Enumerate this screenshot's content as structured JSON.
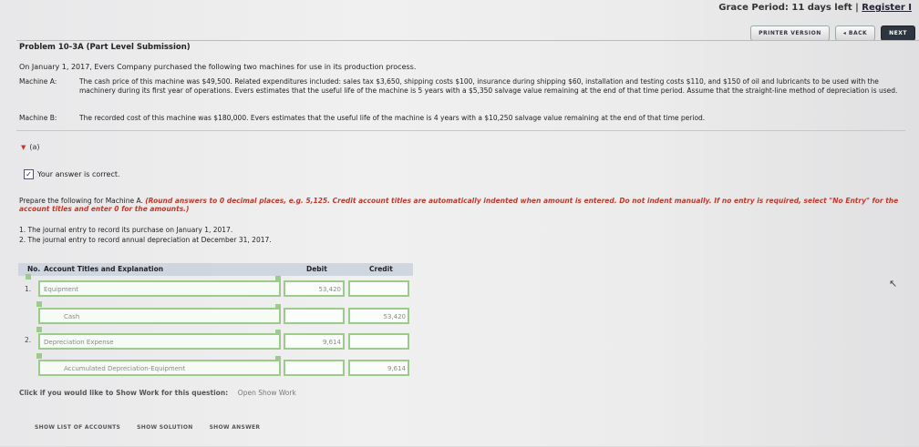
{
  "header": {
    "grace_text": "Grace Period: 11 days left",
    "separator": "|",
    "register_link": "Register I",
    "printer_version": "PRINTER VERSION",
    "back": "◂ BACK",
    "next": "NEXT"
  },
  "problem": {
    "title": "Problem 10-3A (Part Level Submission)",
    "intro": "On January 1, 2017, Evers Company purchased the following two machines for use in its production process.",
    "machine_a_label": "Machine A:",
    "machine_a_text": "The cash price of this machine was $49,500. Related expenditures included: sales tax $3,650, shipping costs $100, insurance during shipping $60, installation and testing costs $110, and $150 of oil and lubricants to be used with the machinery during its first year of operations. Evers estimates that the useful life of the machine is 5 years with a $5,350 salvage value remaining at the end of that time period. Assume that the straight-line method of depreciation is used.",
    "machine_b_label": "Machine B:",
    "machine_b_text": "The recorded cost of this machine was $180,000. Evers estimates that the useful life of the machine is 4 years with a $10,250 salvage value remaining at the end of that time period."
  },
  "part": {
    "label": "(a)",
    "correct_text": "Your answer is correct.",
    "instruction_plain": "Prepare the following for Machine A. ",
    "instruction_red": "(Round answers to 0 decimal places, e.g. 5,125. Credit account titles are automatically indented when amount is entered. Do not indent manually. If no entry is required, select \"No Entry\" for the account titles and enter 0 for the amounts.)",
    "step1": "1.  The journal entry to record its purchase on January 1, 2017.",
    "step2": "2.  The journal entry to record annual depreciation at December 31, 2017."
  },
  "table": {
    "col_no": "No.",
    "col_account": "Account Titles and Explanation",
    "col_debit": "Debit",
    "col_credit": "Credit",
    "rows": [
      {
        "no": "1.",
        "account": "Equipment",
        "debit": "53,420",
        "credit": ""
      },
      {
        "no": "",
        "account": "Cash",
        "debit": "",
        "credit": "53,420"
      },
      {
        "no": "2.",
        "account": "Depreciation Expense",
        "debit": "9,614",
        "credit": ""
      },
      {
        "no": "",
        "account": "Accumulated Depreciation-Equipment",
        "debit": "",
        "credit": "9,614"
      }
    ]
  },
  "show_work": {
    "prompt": "Click if you would like to Show Work for this question:",
    "link": "Open Show Work"
  },
  "footer": {
    "list_accounts": "SHOW LIST OF ACCOUNTS",
    "show_solution": "SHOW SOLUTION",
    "show_answer": "SHOW ANSWER"
  },
  "colors": {
    "accent_red": "#c0392b",
    "field_green": "#9bcc8b",
    "header_blue": "#cfd6e0"
  }
}
